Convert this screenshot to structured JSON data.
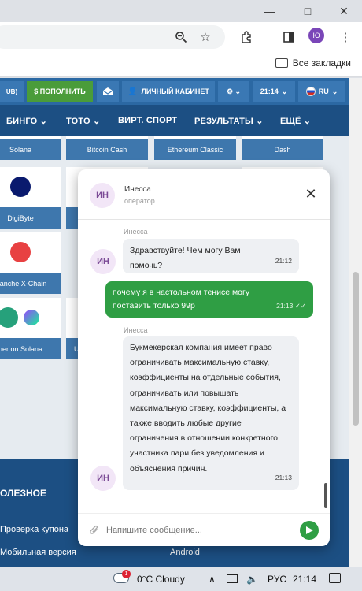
{
  "browser": {
    "profile_initials": "Ю",
    "bookmarks_all": "Все закладки"
  },
  "site": {
    "topbar": {
      "balance_stub": "UB)",
      "deposit": "$ ПОПОЛНИТЬ",
      "cabinet": "ЛИЧНЫЙ КАБИНЕТ",
      "time": "21:14",
      "lang": "RU"
    },
    "nav": [
      "БИНГО",
      "ТОТО",
      "ВИРТ. СПОРТ",
      "РЕЗУЛЬТАТЫ",
      "ЕЩЁ"
    ],
    "coins_row1": [
      "Solana",
      "Bitcoin Cash",
      "Ethereum Classic",
      "Dash"
    ],
    "coins_row2": [
      "DigiByte"
    ],
    "coins_row3": [
      "alanche X-Chain"
    ],
    "coins_row4": [
      "her on Solana",
      "U"
    ],
    "footer": {
      "title": "ОЛЕЗНОЕ",
      "link1": "Проверка купона",
      "link2": "Мобильная версия",
      "link3": "Android"
    }
  },
  "chat": {
    "operator_initials": "ИН",
    "operator_name": "Инесса",
    "operator_role": "оператор",
    "messages": [
      {
        "author": "Инесса",
        "text": "Здравствуйте! Чем могу Вам помочь?",
        "time": "21:12"
      },
      {
        "author": "me",
        "text": "почему я в настольном тенисе могу поставить только 99р",
        "time": "21:13"
      },
      {
        "author": "Инесса",
        "text": "Букмекерская компания имеет право ограничивать максимальную ставку, коэффициенты на отдельные события, ограничивать или повышать максимальную ставку, коэффициенты, а также вводить любые другие ограничения в отношении конкретного участника пари без уведомления и объяснения причин.",
        "time": "21:13"
      }
    ],
    "input_placeholder": "Напишите сообщение..."
  },
  "taskbar": {
    "weather": "0°C  Cloudy",
    "notif_count": "1",
    "lang": "РУС",
    "time": "21:14"
  }
}
